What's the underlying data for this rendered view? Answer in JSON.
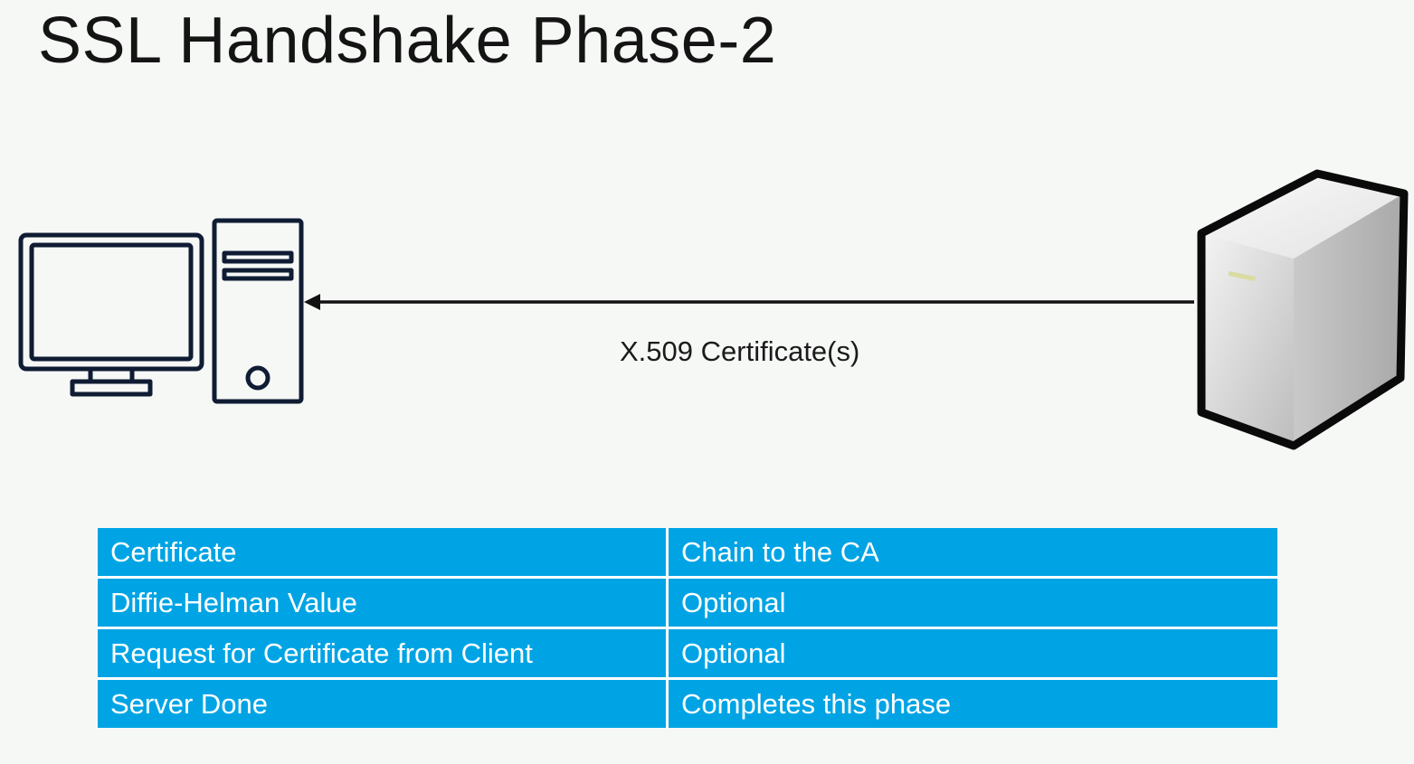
{
  "slide": {
    "title": "SSL Handshake Phase-2"
  },
  "diagram": {
    "left_node_icon": "desktop-computer-icon",
    "right_node_icon": "server-tower-icon",
    "arrow_direction": "server-to-client",
    "arrow_label": "X.509 Certificate(s)"
  },
  "table": {
    "rows": [
      {
        "item": "Certificate",
        "note": "Chain to the CA"
      },
      {
        "item": "Diffie-Helman Value",
        "note": "Optional"
      },
      {
        "item": "Request for Certificate from Client",
        "note": "Optional"
      },
      {
        "item": "Server Done",
        "note": "Completes this phase"
      }
    ]
  },
  "colors": {
    "table_fill": "#00a4e4",
    "table_text": "#ffffff",
    "background": "#f6f8f6",
    "icon_stroke": "#0f1c33"
  }
}
